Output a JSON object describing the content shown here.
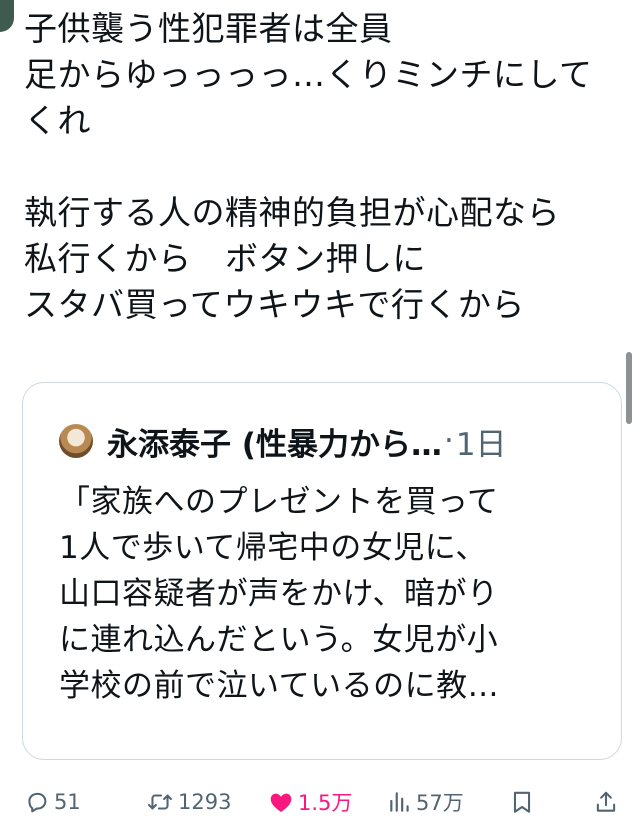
{
  "post": {
    "lines": [
      "子供襲う性犯罪者は全員",
      "足からゆっっっっ…くりミンチにして",
      "くれ",
      "",
      "執行する人の精神的負担が心配なら",
      "私行くから　ボタン押しに",
      "スタバ買ってウキウキで行くから"
    ]
  },
  "quote": {
    "author_name": "永添泰子 (性暴力から…",
    "separator": "·",
    "time": "1日",
    "lines": [
      "「家族へのプレゼントを買って",
      "1人で歩いて帰宅中の女児に、",
      "山口容疑者が声をかけ、暗がり",
      "に連れ込んだという。女児が小",
      "学校の前で泣いているのに教…"
    ]
  },
  "actions": {
    "replies": "51",
    "reposts": "1293",
    "likes": "1.5万",
    "views": "57万",
    "liked": true
  },
  "colors": {
    "text": "#0f1419",
    "secondary": "#536471",
    "like_pink": "#f91880",
    "border": "#cfd9de"
  },
  "icons": [
    "reply-icon",
    "repost-icon",
    "heart-icon",
    "views-icon",
    "bookmark-icon",
    "share-icon"
  ]
}
